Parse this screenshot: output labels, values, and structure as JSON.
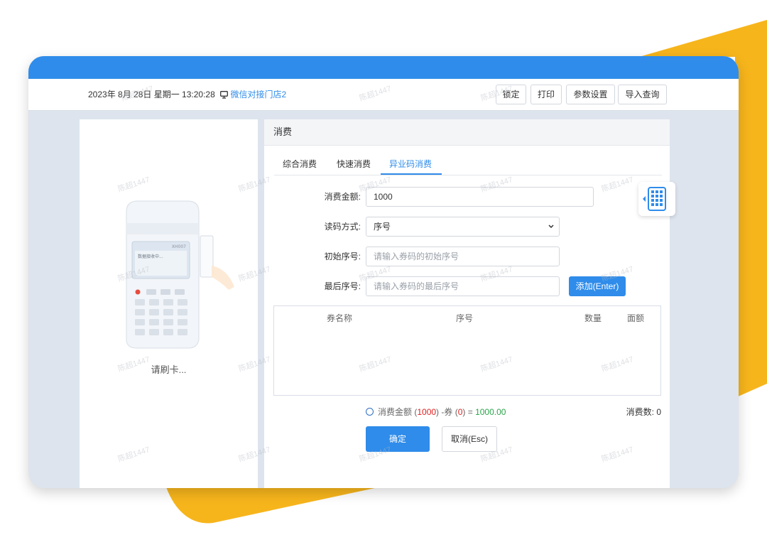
{
  "header": {
    "datetime": "2023年 8月 28日  星期一  13:20:28",
    "store_name": "微信对接门店2",
    "buttons": [
      "锁定",
      "打印",
      "参数设置",
      "导入查询"
    ]
  },
  "left_panel": {
    "device_model": "XH007",
    "device_screen_text": "数据接收中...",
    "swipe_prompt": "请刷卡..."
  },
  "main": {
    "panel_title": "消费",
    "tabs": [
      {
        "label": "综合消费",
        "active": false
      },
      {
        "label": "快速消费",
        "active": false
      },
      {
        "label": "异业码消费",
        "active": true
      }
    ],
    "form": {
      "amount_label": "消费金额:",
      "amount_value": "1000",
      "read_mode_label": "读码方式:",
      "read_mode_value": "序号",
      "start_serial_label": "初始序号:",
      "start_serial_placeholder": "请输入券码的初始序号",
      "end_serial_label": "最后序号:",
      "end_serial_placeholder": "请输入券码的最后序号",
      "add_button": "添加(Enter)"
    },
    "table": {
      "columns": [
        "券名称",
        "序号",
        "数量",
        "面额"
      ],
      "rows": []
    },
    "summary": {
      "prefix": "消费金额 (",
      "amount": "1000",
      "mid": ") -券 (",
      "voucher": "0",
      "suffix": ") = ",
      "total": "1000.00",
      "count_label": "消费数:",
      "count_value": "0"
    },
    "confirm_button": "确定",
    "cancel_button": "取消(Esc)"
  },
  "watermark": "陈超1447",
  "colors": {
    "primary": "#2f8cea",
    "accent_yellow": "#f7b51c",
    "red": "#e02020",
    "green": "#2aa54a"
  },
  "icons": [
    "monitor-icon",
    "info-icon",
    "keypad-icon",
    "pos-terminal-illustration"
  ]
}
